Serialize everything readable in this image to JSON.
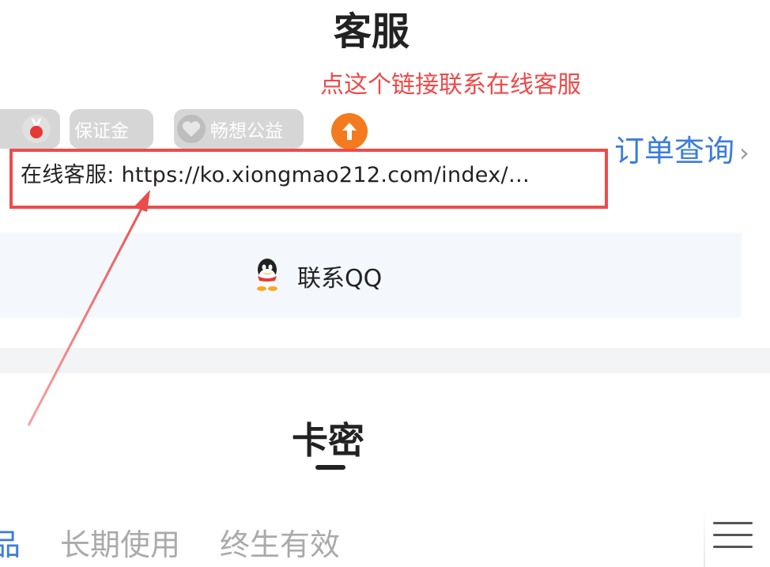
{
  "page_title": "客服",
  "annotation_text": "点这个链接联系在线客服",
  "badges": [
    {
      "label": ""
    },
    {
      "label": "保证金"
    },
    {
      "label": "畅想公益"
    }
  ],
  "order_link": {
    "label": "订单查询",
    "chevron": "›"
  },
  "customer_service": {
    "label": "在线客服: ",
    "url": "https://ko.xiongmao212.com/index/…"
  },
  "contact_qq": {
    "label": "联系QQ"
  },
  "card_section_title": "卡密",
  "tabs": [
    {
      "label": "品"
    },
    {
      "label": "长期使用"
    },
    {
      "label": "终生有效"
    }
  ],
  "colors": {
    "accent_blue": "#3a7ce0",
    "annotation_red": "#ef4a4a",
    "orange_icon": "#f47a1f"
  }
}
